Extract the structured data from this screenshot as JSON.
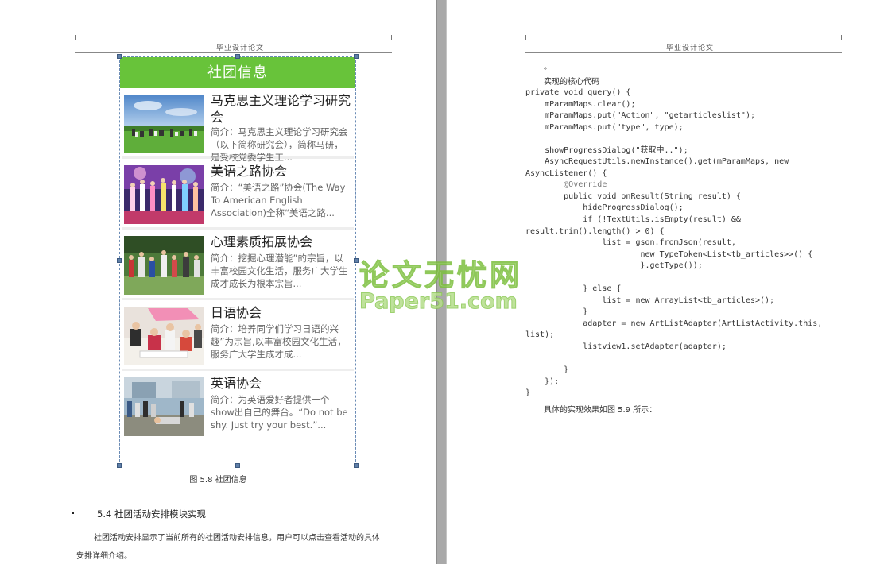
{
  "header_text": "毕业设计论文",
  "left_page": {
    "app": {
      "title": "社团信息",
      "clubs": [
        {
          "name": "马克思主义理论学习研究会",
          "desc": "简介：马克思主义理论学习研究会（以下简称研究会），简称马研，是受校党委学生工..."
        },
        {
          "name": "美语之路协会",
          "desc": "简介：“美语之路”协会(The Way To American English Association)全称“美语之路..."
        },
        {
          "name": "心理素质拓展协会",
          "desc": "简介：挖掘心理潜能”的宗旨，以丰富校园文化生活，服务广大学生成才成长为根本宗旨..."
        },
        {
          "name": "日语协会",
          "desc": "简介：培养同学们学习日语的兴趣”为宗旨,以丰富校园文化生活，服务广大学生成才成..."
        },
        {
          "name": "英语协会",
          "desc": "简介：为英语爱好者提供一个show出自己的舞台。“Do not be shy. Just try your best.”..."
        }
      ]
    },
    "caption": "图 5.8  社团信息",
    "section_title": "5.4 社团活动安排模块实现",
    "paragraph": "社团活动安排显示了当前所有的社团活动安排信息，用户可以点击查看活动的具体安排详细介绍。"
  },
  "right_page": {
    "intro_dot": "。",
    "intro": "实现的核心代码",
    "code_lines": [
      "private void query() {",
      "    mParamMaps.clear();",
      "    mParamMaps.put(\"Action\", \"getarticleslist\");",
      "    mParamMaps.put(\"type\", type);",
      "",
      "    showProgressDialog(\"获取中..\");",
      "    AsyncRequestUtils.newInstance().get(mParamMaps, new",
      "AsyncListener() {",
      "        @Override",
      "        public void onResult(String result) {",
      "            hideProgressDialog();",
      "            if (!TextUtils.isEmpty(result) &&",
      "result.trim().length() > 0) {",
      "                list = gson.fromJson(result,",
      "                        new TypeToken<List<tb_articles>>() {",
      "                        }.getType());",
      "",
      "            } else {",
      "                list = new ArrayList<tb_articles>();",
      "            }",
      "            adapter = new ArtListAdapter(ArtListActivity.this,",
      "list);",
      "            listview1.setAdapter(adapter);",
      "",
      "        }",
      "    });",
      "}"
    ],
    "outro": "具体的实现效果如图 5.9 所示："
  },
  "watermark": {
    "cn": "论文无忧网",
    "en": "Paper51.com"
  }
}
